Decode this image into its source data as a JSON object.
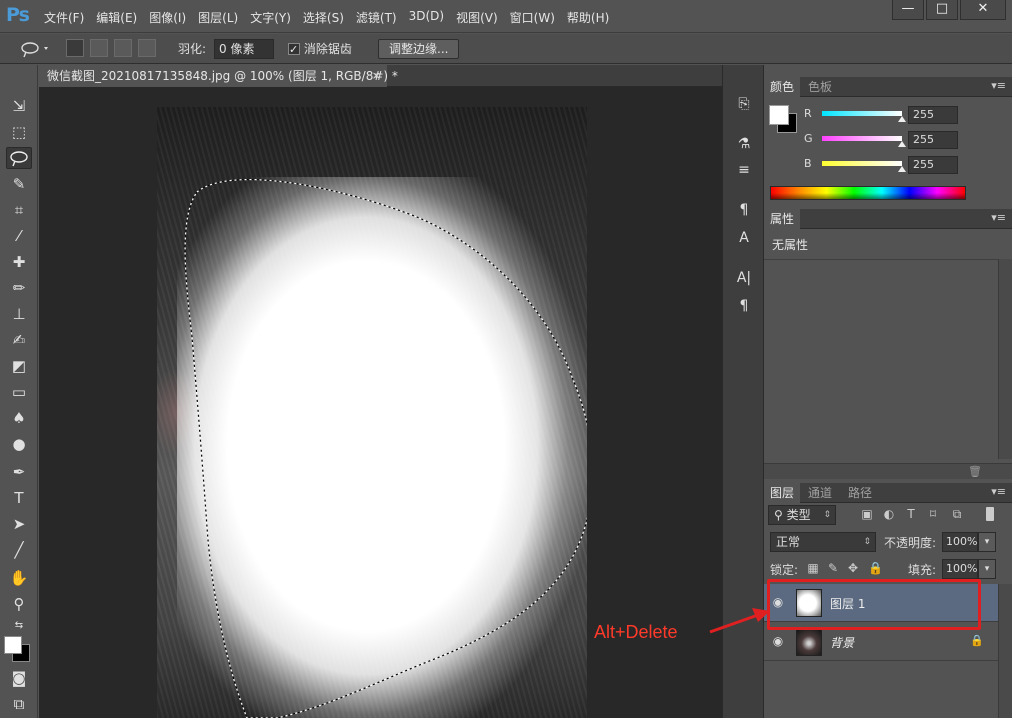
{
  "app": {
    "logo": "Ps"
  },
  "menu": [
    "文件(F)",
    "编辑(E)",
    "图像(I)",
    "图层(L)",
    "文字(Y)",
    "选择(S)",
    "滤镜(T)",
    "3D(D)",
    "视图(V)",
    "窗口(W)",
    "帮助(H)"
  ],
  "window_controls": {
    "minimize": "—",
    "maximize": "□",
    "close": "✕"
  },
  "options": {
    "feather_label": "羽化:",
    "feather_value": "0 像素",
    "antialias_label": "消除锯齿",
    "refine_button": "调整边缘..."
  },
  "document": {
    "tab_title": "微信截图_20210817135848.jpg @ 100% (图层 1, RGB/8#) *",
    "tab_close": "×"
  },
  "tools": [
    "move-tool",
    "marquee-tool",
    "lasso-tool",
    "quick-select-tool",
    "crop-tool",
    "eyedropper-tool",
    "healing-tool",
    "brush-tool",
    "clone-stamp-tool",
    "history-brush-tool",
    "eraser-tool",
    "gradient-tool",
    "blur-tool",
    "dodge-tool",
    "pen-tool",
    "type-tool",
    "path-select-tool",
    "line-tool",
    "hand-tool",
    "zoom-tool"
  ],
  "color_panel": {
    "tabs": [
      "颜色",
      "色板"
    ],
    "channels": [
      {
        "letter": "R",
        "value": "255",
        "gradient": "#00e5ff"
      },
      {
        "letter": "G",
        "value": "255",
        "gradient": "#ff40ff"
      },
      {
        "letter": "B",
        "value": "255",
        "gradient": "#ffff30"
      }
    ],
    "foreground": "#ffffff",
    "background": "#000000"
  },
  "properties_panel": {
    "tab": "属性",
    "content": "无属性"
  },
  "layers_panel": {
    "tabs": [
      "图层",
      "通道",
      "路径"
    ],
    "filter_label": "类型",
    "blend_mode": "正常",
    "opacity_label": "不透明度:",
    "opacity_value": "100%",
    "lock_label": "锁定:",
    "fill_label": "填充:",
    "fill_value": "100%",
    "layers": [
      {
        "name": "图层 1",
        "selected": true,
        "locked": false
      },
      {
        "name": "背景",
        "selected": false,
        "locked": true
      }
    ]
  },
  "annotation": {
    "text": "Alt+Delete",
    "color": "#ff3a2a"
  }
}
